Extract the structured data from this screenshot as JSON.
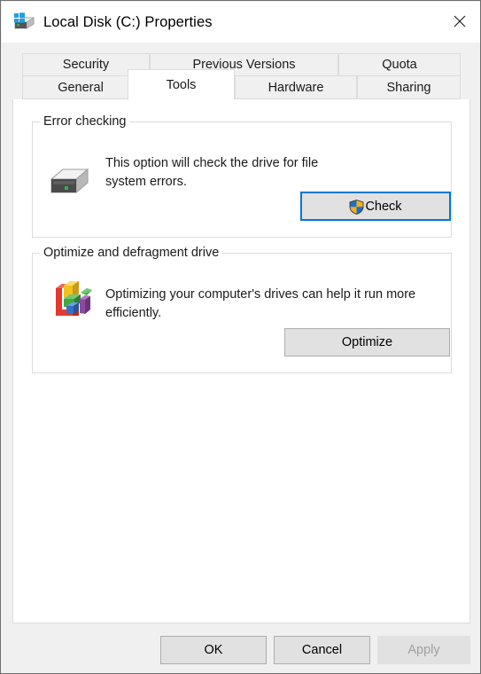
{
  "window": {
    "title": "Local Disk (C:) Properties",
    "icon": "system-drive-icon",
    "close_label": "✕"
  },
  "tabs": {
    "row1": [
      {
        "label": "Security",
        "active": false
      },
      {
        "label": "Previous Versions",
        "active": false
      },
      {
        "label": "Quota",
        "active": false
      }
    ],
    "row2": [
      {
        "label": "General",
        "active": false
      },
      {
        "label": "Tools",
        "active": true
      },
      {
        "label": "Hardware",
        "active": false
      },
      {
        "label": "Sharing",
        "active": false
      }
    ]
  },
  "groups": {
    "error_checking": {
      "title": "Error checking",
      "icon": "hard-drive-icon",
      "description": "This option will check the drive for file system errors.",
      "button": {
        "label": "Check",
        "icon": "uac-shield-icon",
        "focused": true,
        "enabled": true
      }
    },
    "optimize": {
      "title": "Optimize and defragment drive",
      "icon": "defragment-icon",
      "description": "Optimizing your computer's drives can help it run more efficiently.",
      "button": {
        "label": "Optimize",
        "focused": false,
        "enabled": true
      }
    }
  },
  "footer": {
    "ok_label": "OK",
    "cancel_label": "Cancel",
    "apply_label": "Apply",
    "apply_enabled": false
  },
  "colors": {
    "accent": "#0078d7",
    "dialog_bg": "#f0f0f0",
    "panel_bg": "#ffffff",
    "button_face": "#e1e1e1",
    "button_border": "#adadad",
    "group_border": "#dcdcdc",
    "disabled_text": "#a0a0a0",
    "shield_blue": "#1d6fc4",
    "shield_yellow": "#f2b01e",
    "drive_led_green": "#2bb24c"
  }
}
